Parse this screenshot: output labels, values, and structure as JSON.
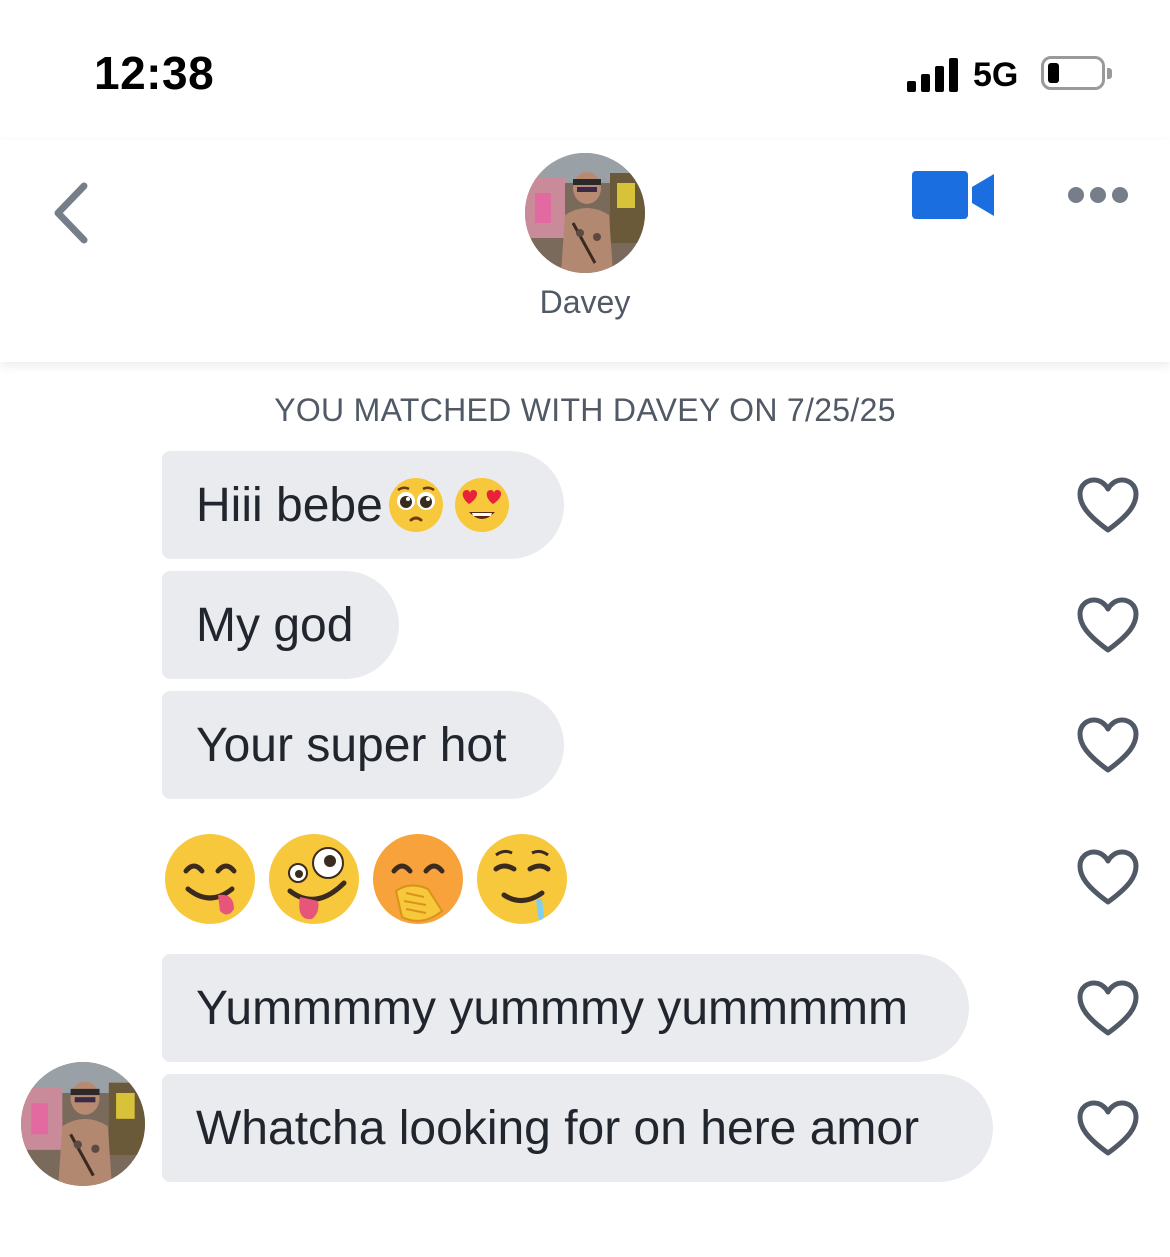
{
  "status_bar": {
    "time": "12:38",
    "network": "5G"
  },
  "header": {
    "contact_name": "Davey",
    "back_icon": "chevron-left-icon",
    "video_icon": "video-camera-icon",
    "more_icon": "more-horizontal-icon",
    "accent_color": "#1a6ee0"
  },
  "conversation": {
    "match_note": "YOU MATCHED WITH DAVEY ON 7/25/25",
    "messages": [
      {
        "text": "Hiii bebe",
        "emojis": [
          "pleading-face",
          "smiling-face-with-heart-eyes"
        ]
      },
      {
        "text": "My god"
      },
      {
        "text": "Your super hot"
      },
      {
        "text": "",
        "emojis": [
          "face-savoring-food",
          "zany-face",
          "face-with-hand-over-mouth",
          "drooling-face"
        ]
      },
      {
        "text": "Yummmmy yummmy yummmmm"
      },
      {
        "text": "Whatcha looking for on here amor"
      }
    ]
  }
}
